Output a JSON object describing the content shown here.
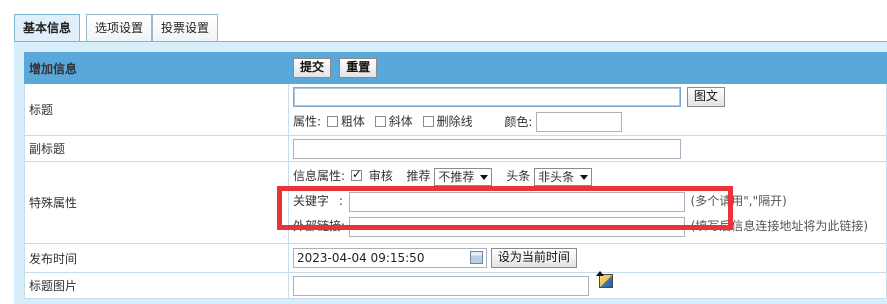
{
  "tabs": [
    {
      "label": "基本信息",
      "active": true
    },
    {
      "label": "选项设置",
      "active": false
    },
    {
      "label": "投票设置",
      "active": false
    }
  ],
  "form": {
    "header_title": "增加信息",
    "submit_label": "提交",
    "reset_label": "重置",
    "title_label": "标题",
    "tuwen_label": "图文",
    "attr_label": "属性:",
    "bold_label": "粗体",
    "italic_label": "斜体",
    "strike_label": "删除线",
    "color_label": "颜色:",
    "subtitle_label": "副标题",
    "special_label": "特殊属性",
    "info_attr_label": "信息属性:",
    "audit_label": "审核",
    "recommend_label": "推荐",
    "recommend_value": "不推荐",
    "headline_label": "头条",
    "headline_value": "非头条",
    "keyword_label": "关键字",
    "keyword_colon": ":",
    "keyword_hint": "(多个请用\",\"隔开)",
    "external_link_label": "外部链接:",
    "external_link_hint": "(填写后信息连接地址将为此链接)",
    "publish_time_label": "发布时间",
    "publish_time_value": "2023-04-04 09:15:50",
    "set_now_label": "设为当前时间",
    "title_image_label": "标题图片"
  },
  "colors": {
    "header_bg": "#5aa7d9",
    "highlight": "#e8333b",
    "panel_bg": "#d8eefa"
  },
  "icons": [
    "calendar-icon",
    "image-select-icon",
    "checkbox-checked-icon"
  ]
}
